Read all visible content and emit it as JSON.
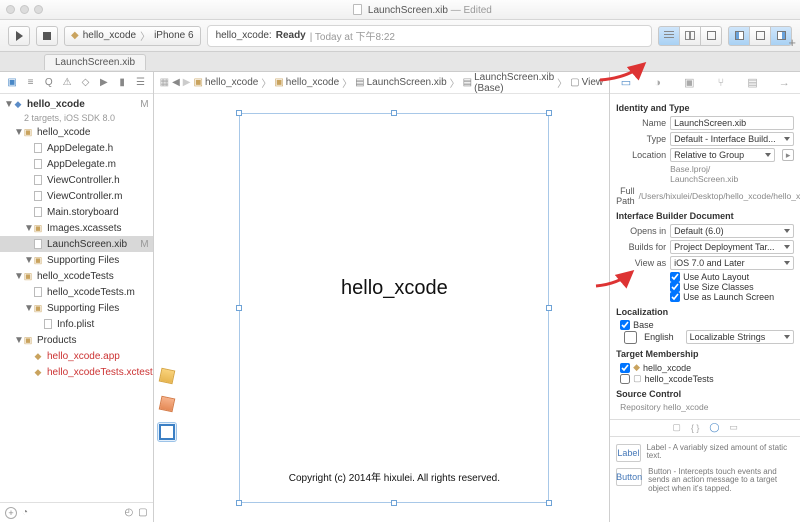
{
  "window": {
    "title": "LaunchScreen.xib",
    "edited": "— Edited"
  },
  "toolbar": {
    "scheme_app": "hello_xcode",
    "scheme_dest": "iPhone 6",
    "activity_prefix": "hello_xcode:",
    "activity_status": "Ready",
    "activity_time": "| Today at 下午8:22"
  },
  "tab": {
    "name": "LaunchScreen.xib"
  },
  "navigator": {
    "project": "hello_xcode",
    "project_sub": "2 targets, iOS SDK 8.0",
    "m_badge": "M",
    "groups": [
      {
        "label": "hello_xcode",
        "kind": "folder"
      },
      {
        "label": "AppDelegate.h",
        "kind": "file",
        "indent": 2
      },
      {
        "label": "AppDelegate.m",
        "kind": "file",
        "indent": 2
      },
      {
        "label": "ViewController.h",
        "kind": "file",
        "indent": 2
      },
      {
        "label": "ViewController.m",
        "kind": "file",
        "indent": 2
      },
      {
        "label": "Main.storyboard",
        "kind": "xib",
        "indent": 2
      },
      {
        "label": "Images.xcassets",
        "kind": "folder",
        "indent": 2
      },
      {
        "label": "LaunchScreen.xib",
        "kind": "xib",
        "indent": 2,
        "selected": true,
        "badge": "M"
      },
      {
        "label": "Supporting Files",
        "kind": "folder",
        "indent": 2
      },
      {
        "label": "hello_xcodeTests",
        "kind": "folder"
      },
      {
        "label": "hello_xcodeTests.m",
        "kind": "file",
        "indent": 2
      },
      {
        "label": "Supporting Files",
        "kind": "folder",
        "indent": 2
      },
      {
        "label": "Info.plist",
        "kind": "file",
        "indent": 3
      },
      {
        "label": "Products",
        "kind": "folder"
      },
      {
        "label": "hello_xcode.app",
        "kind": "product",
        "indent": 2,
        "color": "red"
      },
      {
        "label": "hello_xcodeTests.xctest",
        "kind": "product",
        "indent": 2,
        "color": "red"
      }
    ]
  },
  "jumpbar": {
    "items": [
      "hello_xcode",
      "hello_xcode",
      "LaunchScreen.xib",
      "LaunchScreen.xib (Base)",
      "View"
    ]
  },
  "canvas": {
    "title": "hello_xcode",
    "copyright": "Copyright (c) 2014年 hixulei. All rights reserved."
  },
  "inspector": {
    "identity_title": "Identity and Type",
    "name_lbl": "Name",
    "name_val": "LaunchScreen.xib",
    "type_lbl": "Type",
    "type_val": "Default - Interface Build...",
    "location_lbl": "Location",
    "location_val": "Relative to Group",
    "location_path": "Base.lproj/\nLaunchScreen.xib",
    "fullpath_lbl": "Full Path",
    "fullpath_val": "/Users/hixulei/Desktop/hello_xcode/hello_xcode/Base.lproj/LaunchScreen.xib",
    "ib_title": "Interface Builder Document",
    "opens_lbl": "Opens in",
    "opens_val": "Default (6.0)",
    "builds_lbl": "Builds for",
    "builds_val": "Project Deployment Tar...",
    "view_lbl": "View as",
    "view_val": "iOS 7.0 and Later",
    "chk1": "Use Auto Layout",
    "chk2": "Use Size Classes",
    "chk3": "Use as Launch Screen",
    "loc_title": "Localization",
    "loc_base": "Base",
    "loc_english": "English",
    "loc_strings": "Localizable Strings",
    "target_title": "Target Membership",
    "target1": "hello_xcode",
    "target2": "hello_xcodeTests",
    "source_title": "Source Control",
    "source_repo": "Repository hello_xcode",
    "lib_label": "Label",
    "lib_label_desc": "Label - A variably sized amount of static text.",
    "lib_button": "Button",
    "lib_button_desc": "Button - Intercepts touch events and sends an action message to a target object when it's tapped."
  }
}
